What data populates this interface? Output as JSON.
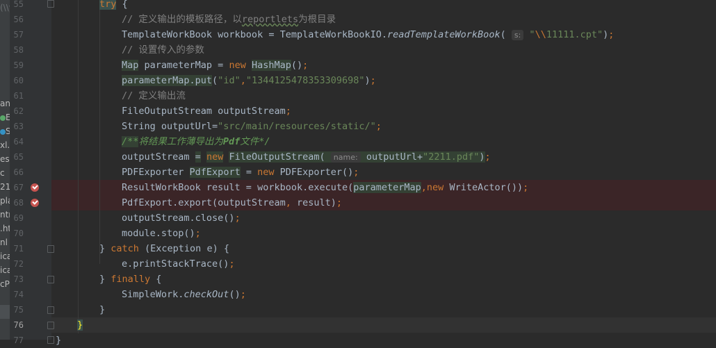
{
  "project_panel": {
    "items": [
      "(\\\\y",
      "anr",
      "E",
      "S",
      "xl.p",
      "es",
      "c",
      "21",
      "pla",
      "ntn",
      ".ht",
      "nl",
      "ica",
      "ica",
      "cPc"
    ]
  },
  "editor": {
    "lines": [
      {
        "n": "55",
        "t": "try {"
      },
      {
        "n": "56",
        "t": "// 定义输出的模板路径，以reportlets为根目录"
      },
      {
        "n": "57",
        "t": "TemplateWorkBook workbook = TemplateWorkBookIO.readTemplateWorkBook( s: \"\\\\11111.cpt\");"
      },
      {
        "n": "58",
        "t": "// 设置传入的参数"
      },
      {
        "n": "59",
        "t": "Map parameterMap = new HashMap();"
      },
      {
        "n": "60",
        "t": "parameterMap.put(\"id\",\"1344125478353309698\");"
      },
      {
        "n": "61",
        "t": "// 定义输出流"
      },
      {
        "n": "62",
        "t": "FileOutputStream outputStream;"
      },
      {
        "n": "63",
        "t": "String outputUrl=\"src/main/resources/static/\";"
      },
      {
        "n": "64",
        "t": "/**将结果工作薄导出为Pdf文件*/"
      },
      {
        "n": "65",
        "t": "outputStream = new FileOutputStream( name: outputUrl+\"2211.pdf\");"
      },
      {
        "n": "66",
        "t": "PDFExporter PdfExport = new PDFExporter();"
      },
      {
        "n": "67",
        "t": "ResultWorkBook result = workbook.execute(parameterMap,new WriteActor());"
      },
      {
        "n": "68",
        "t": "PdfExport.export(outputStream, result);"
      },
      {
        "n": "69",
        "t": "outputStream.close();"
      },
      {
        "n": "70",
        "t": "module.stop();"
      },
      {
        "n": "71",
        "t": "} catch (Exception e) {"
      },
      {
        "n": "72",
        "t": "e.printStackTrace();"
      },
      {
        "n": "73",
        "t": "} finally {"
      },
      {
        "n": "74",
        "t": "SimpleWork.checkOut();"
      },
      {
        "n": "75",
        "t": "}"
      },
      {
        "n": "76",
        "t": "}"
      },
      {
        "n": "77",
        "t": "}"
      }
    ],
    "hints": {
      "s": "s:",
      "name": "name:"
    },
    "colors": {
      "keyword": "#cc7832",
      "string": "#6a8759",
      "comment": "#808080",
      "text": "#a9b7c6",
      "breakpoint": "#c75450",
      "background": "#2b2b2b"
    }
  }
}
